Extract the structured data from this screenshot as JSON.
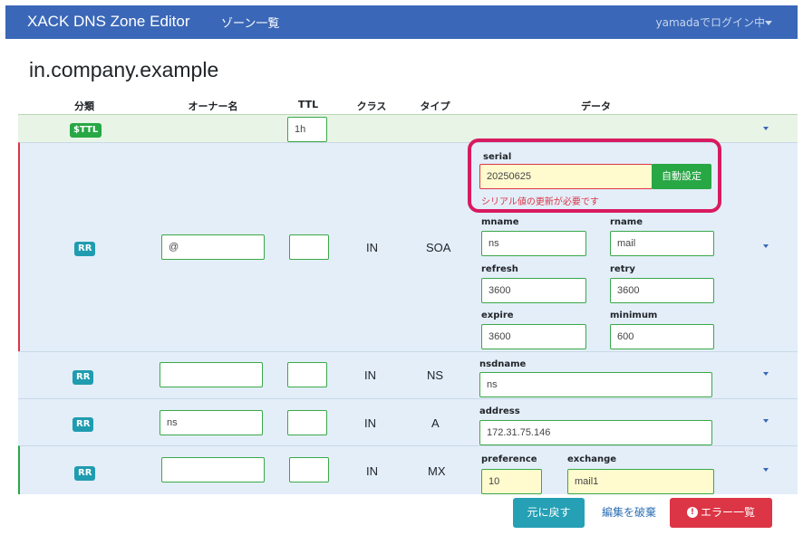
{
  "navbar": {
    "brand": "XACK DNS Zone Editor",
    "zone_list_link": "ゾーン一覧",
    "user_status": "yamadaでログイン中"
  },
  "zone": {
    "name": "in.company.example"
  },
  "headers": {
    "category": "分類",
    "owner": "オーナー名",
    "ttl": "TTL",
    "class": "クラス",
    "type": "タイプ",
    "data": "データ"
  },
  "rows": {
    "ttl": {
      "badge": "$TTL",
      "ttl_value": "1h"
    },
    "soa": {
      "badge": "RR",
      "owner": "@",
      "ttl": "",
      "class": "IN",
      "type": "SOA",
      "serial_label": "serial",
      "serial_value": "20250625",
      "auto_button": "自動設定",
      "serial_error": "シリアル値の更新が必要です",
      "mname_label": "mname",
      "mname_value": "ns",
      "rname_label": "rname",
      "rname_value": "mail",
      "refresh_label": "refresh",
      "refresh_value": "3600",
      "retry_label": "retry",
      "retry_value": "3600",
      "expire_label": "expire",
      "expire_value": "3600",
      "minimum_label": "minimum",
      "minimum_value": "600"
    },
    "ns": {
      "badge": "RR",
      "owner": "",
      "ttl": "",
      "class": "IN",
      "type": "NS",
      "nsdname_label": "nsdname",
      "nsdname_value": "ns"
    },
    "a": {
      "badge": "RR",
      "owner": "ns",
      "ttl": "",
      "class": "IN",
      "type": "A",
      "address_label": "address",
      "address_value": "172.31.75.146"
    },
    "mx": {
      "badge": "RR",
      "owner": "",
      "ttl": "",
      "class": "IN",
      "type": "MX",
      "preference_label": "preference",
      "preference_value": "10",
      "exchange_label": "exchange",
      "exchange_value": "mail1"
    }
  },
  "footer": {
    "revert_button": "元に戻す",
    "discard_link": "編集を破棄",
    "errors_button": "エラー一覧",
    "errors_icon": "!"
  },
  "colors": {
    "navbar": "#3a67b7",
    "valid_border": "#3aa848",
    "error": "#dc3545",
    "highlight": "#d81b60",
    "badge_rr": "#1f9cb0",
    "badge_ttl": "#28a745"
  },
  "icons": [
    "caret-down-icon",
    "exclamation-circle-icon"
  ]
}
